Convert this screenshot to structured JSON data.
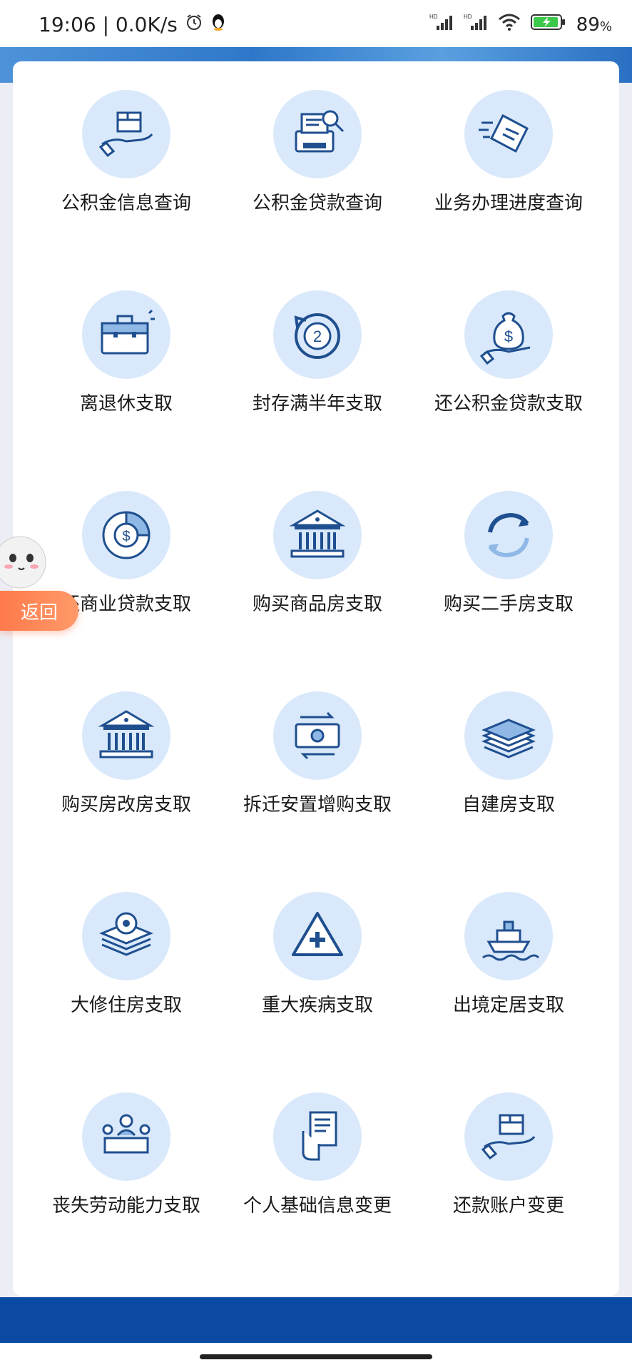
{
  "status_bar": {
    "time_speed": "19:06 | 0.0K/s",
    "battery_pct": "89",
    "battery_unit": "%",
    "network_1": "HD",
    "network_2": "HD"
  },
  "tiles": [
    {
      "label": "公积金信息查询",
      "icon": "hand-box-icon"
    },
    {
      "label": "公积金贷款查询",
      "icon": "printer-search-icon"
    },
    {
      "label": "业务办理进度查询",
      "icon": "document-fast-icon"
    },
    {
      "label": "离退休支取",
      "icon": "briefcase-icon"
    },
    {
      "label": "封存满半年支取",
      "icon": "circular-arrow-2-icon"
    },
    {
      "label": "还公积金贷款支取",
      "icon": "money-bag-hand-icon"
    },
    {
      "label": "还商业贷款支取",
      "icon": "dollar-pie-icon"
    },
    {
      "label": "购买商品房支取",
      "icon": "bank-building-icon"
    },
    {
      "label": "购买二手房支取",
      "icon": "refresh-arrows-icon"
    },
    {
      "label": "购买房改房支取",
      "icon": "bank-building-icon"
    },
    {
      "label": "拆迁安置增购支取",
      "icon": "cash-exchange-icon"
    },
    {
      "label": "自建房支取",
      "icon": "cash-stack-icon"
    },
    {
      "label": "大修住房支取",
      "icon": "gear-layers-icon"
    },
    {
      "label": "重大疾病支取",
      "icon": "medical-cross-icon"
    },
    {
      "label": "出境定居支取",
      "icon": "ship-icon"
    },
    {
      "label": "丧失劳动能力支取",
      "icon": "meeting-people-icon"
    },
    {
      "label": "个人基础信息变更",
      "icon": "hand-document-icon"
    },
    {
      "label": "还款账户变更",
      "icon": "hand-box-icon"
    }
  ],
  "back_button": {
    "label": "返回"
  },
  "colors": {
    "accent": "#0a4aa3",
    "icon_bg": "#d9e9fb",
    "icon_stroke": "#1f4f8f",
    "back_button": "#ff8a5a"
  }
}
